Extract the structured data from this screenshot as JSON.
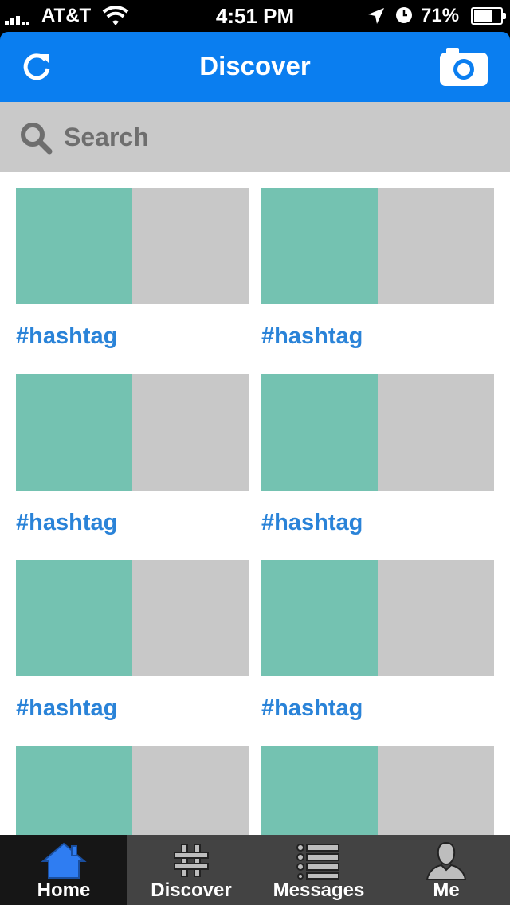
{
  "status_bar": {
    "carrier": "AT&T",
    "time": "4:51 PM",
    "battery_percent": "71%",
    "battery_level": 0.71,
    "icons": [
      "signal-icon",
      "wifi-icon",
      "location-arrow-icon",
      "alarm-clock-icon",
      "battery-icon"
    ]
  },
  "nav": {
    "title": "Discover",
    "left_icon": "refresh-icon",
    "right_icon": "camera-icon",
    "color": "#0a7ef0"
  },
  "search": {
    "placeholder": "Search",
    "value": "",
    "icon": "search-icon"
  },
  "tiles": [
    {
      "tag": "#hashtag"
    },
    {
      "tag": "#hashtag"
    },
    {
      "tag": "#hashtag"
    },
    {
      "tag": "#hashtag"
    },
    {
      "tag": "#hashtag"
    },
    {
      "tag": "#hashtag"
    },
    {
      "tag": ""
    },
    {
      "tag": ""
    }
  ],
  "colors": {
    "thumb_primary": "#74c2b1",
    "thumb_secondary": "#c8c8c8",
    "hashtag": "#2a83d8"
  },
  "tabs": [
    {
      "label": "Home",
      "icon": "home-icon",
      "active": true
    },
    {
      "label": "Discover",
      "icon": "hashtag-icon",
      "active": false
    },
    {
      "label": "Messages",
      "icon": "list-icon",
      "active": false
    },
    {
      "label": "Me",
      "icon": "person-icon",
      "active": false
    }
  ]
}
